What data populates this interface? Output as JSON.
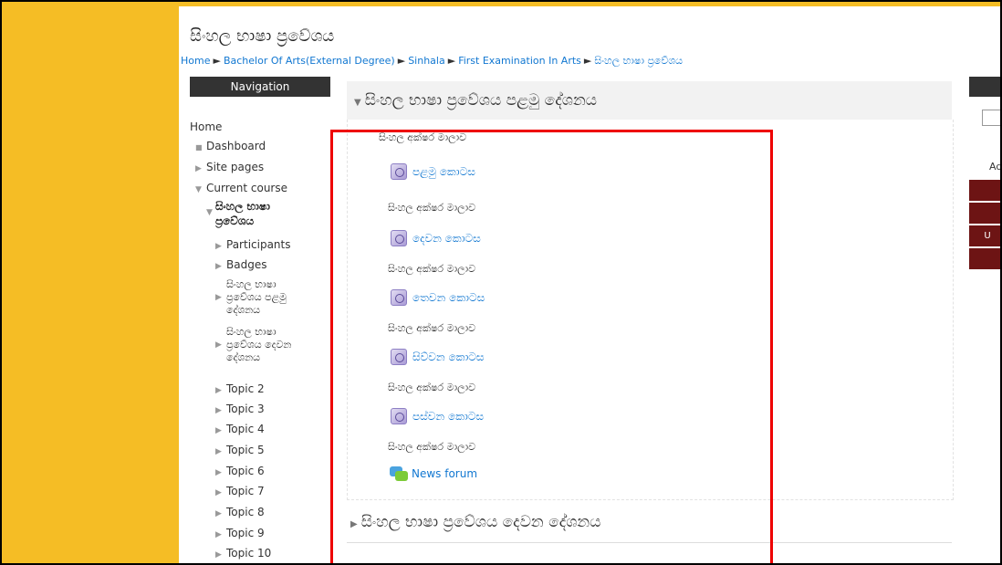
{
  "page": {
    "title": "සිංහල භාෂා ප්‍රවේශය"
  },
  "breadcrumb": [
    "Home",
    "Bachelor Of Arts(External Degree)",
    "Sinhala",
    "First Examination In Arts",
    "සිංහල භාෂා ප්‍රවේශය"
  ],
  "breadcrumb_separator": "►",
  "navigation": {
    "header": "Navigation",
    "home": "Home",
    "dashboard": "Dashboard",
    "site_pages": "Site pages",
    "current_course": "Current course",
    "course_name": "සිංහල භාෂා ප්‍රවේශය",
    "participants": "Participants",
    "badges": "Badges",
    "lecture1": "සිංහල භාෂා ප්‍රවේශය පළමු දේශනය",
    "lecture2": "සිංහල භාෂා ප්‍රවේශය දෙවන දේශනය",
    "topics": [
      "Topic 2",
      "Topic 3",
      "Topic 4",
      "Topic 5",
      "Topic 6",
      "Topic 7",
      "Topic 8",
      "Topic 9",
      "Topic 10"
    ]
  },
  "section1": {
    "title": "සිංහල භාෂා ප්‍රවේශය පළමු දේශනය",
    "intro_text": "සිංහල අක්ෂර මාලාව",
    "activities": [
      {
        "link": "පළමු කොටස",
        "desc": "සිංහල අක්ෂර මාලාව"
      },
      {
        "link": "දෙවන කොටස",
        "desc": "සිංහල අක්ෂර මාලාව"
      },
      {
        "link": "තෙවන කොටස",
        "desc": "සිංහල අක්ෂර මාලාව"
      },
      {
        "link": "සිව්වන කොටස",
        "desc": "සිංහල අක්ෂර මාලාව"
      },
      {
        "link": "පස්වන කොටස",
        "desc": "සිංහල අක්ෂර මාලාව"
      }
    ],
    "forum": "News forum"
  },
  "section2": {
    "title": "සිංහල භාෂා ප්‍රවේශය දෙවන දේශනය"
  },
  "right_block": {
    "adv_label": "Adv",
    "btn_label": "U"
  },
  "colors": {
    "gutter": "#f5bd25",
    "link": "#1177d1",
    "nav_header": "#333333",
    "side_button": "#6d1414",
    "highlight": "#ee0000"
  }
}
